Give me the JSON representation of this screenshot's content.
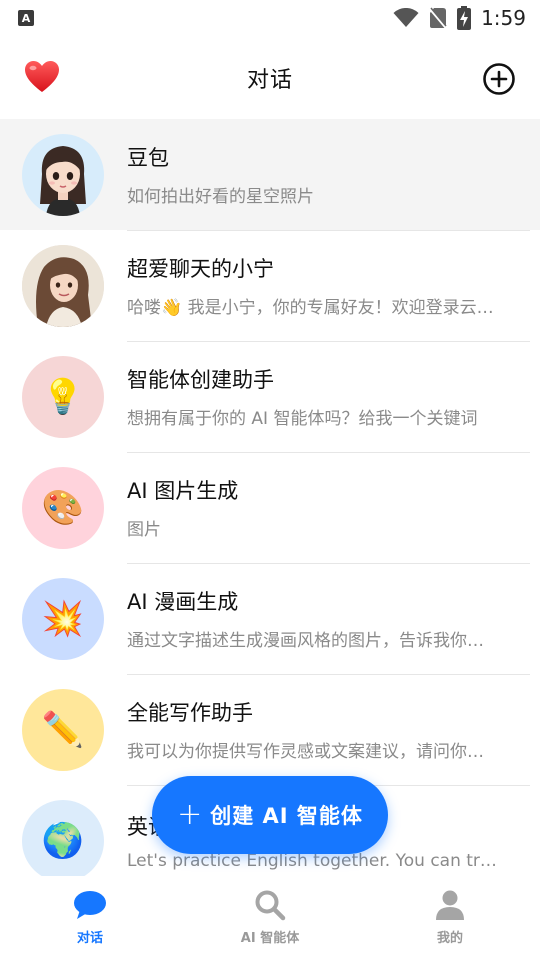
{
  "status_bar": {
    "time": "1:59",
    "indicator_letter": "A"
  },
  "header": {
    "title": "对话"
  },
  "conversations": [
    {
      "name": "豆包",
      "preview": "如何拍出好看的星空照片",
      "avatar_bg": "#d7ecfb",
      "avatar_kind": "girl"
    },
    {
      "name": "超爱聊天的小宁",
      "preview": "哈喽👋 我是小宁，你的专属好友！欢迎登录云端对话",
      "avatar_bg": "#e8e0d6",
      "avatar_kind": "woman"
    },
    {
      "name": "智能体创建助手",
      "preview": "想拥有属于你的 AI 智能体吗？给我一个关键词",
      "avatar_bg": "#f6d6d6",
      "avatar_emoji": "💡"
    },
    {
      "name": "AI 图片生成",
      "preview": "图片",
      "avatar_bg": "#ffd3dc",
      "avatar_emoji": "🎨"
    },
    {
      "name": "AI 漫画生成",
      "preview": "通过文字描述生成漫画风格的图片，告诉我你想要什么",
      "avatar_bg": "#c9dcff",
      "avatar_emoji": "💥"
    },
    {
      "name": "全能写作助手",
      "preview": "我可以为你提供写作灵感或文案建议，请问你需要什么",
      "avatar_bg": "#ffe79a",
      "avatar_emoji": "✏️"
    },
    {
      "name": "英语",
      "preview": "Let's practice English together. You can try talking",
      "avatar_bg": "#dcecfb",
      "avatar_emoji": "🌍"
    }
  ],
  "fab": {
    "plus": "+",
    "label": "创建 AI 智能体"
  },
  "bottom_nav": [
    {
      "label": "对话",
      "icon": "chat-bubble-icon",
      "active": true
    },
    {
      "label": "AI 智能体",
      "icon": "search-icon",
      "active": false
    },
    {
      "label": "我的",
      "icon": "person-icon",
      "active": false
    }
  ],
  "colors": {
    "accent": "#1677ff",
    "heart": "#e8202a",
    "inactive": "#999999"
  }
}
